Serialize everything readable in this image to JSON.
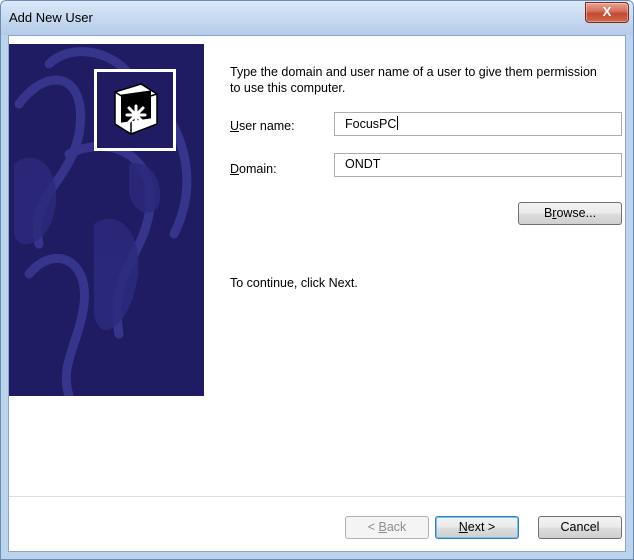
{
  "window": {
    "title": "Add New User",
    "close_label": "X"
  },
  "intro": "Type the domain and user name of a user to give them permission to use this computer.",
  "fields": {
    "username": {
      "label_accel": "U",
      "label_rest": "ser name:",
      "value": "FocusPC"
    },
    "domain": {
      "label_accel": "D",
      "label_rest": "omain:",
      "value": "ONDT"
    }
  },
  "buttons": {
    "browse": {
      "pre": "B",
      "accel": "r",
      "post": "owse..."
    },
    "back": {
      "pre": "< ",
      "accel": "B",
      "post": "ack"
    },
    "next": {
      "pre": "",
      "accel": "N",
      "post": "ext >"
    },
    "cancel": {
      "label": "Cancel"
    }
  },
  "continue_text": "To continue, click Next."
}
